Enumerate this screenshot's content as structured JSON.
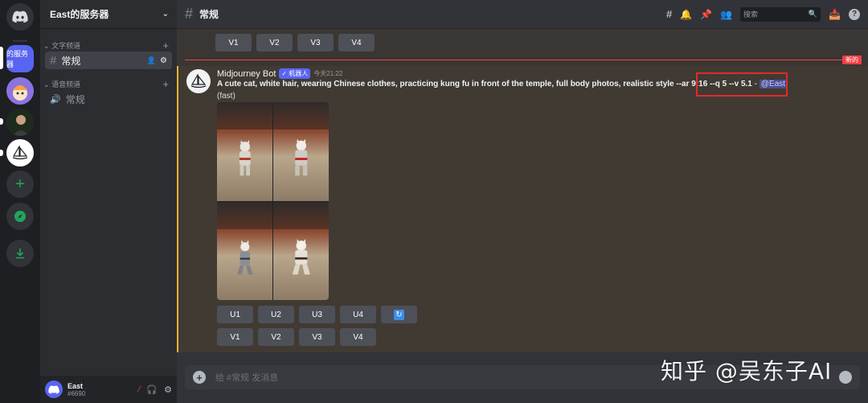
{
  "guild": {
    "name": "East的服务器",
    "short_label": "的服务器"
  },
  "sidebar": {
    "categories": [
      {
        "label": "文字频道",
        "channels": [
          {
            "label": "常规"
          }
        ]
      },
      {
        "label": "语音频道",
        "channels": [
          {
            "label": "常规"
          }
        ]
      }
    ]
  },
  "user": {
    "name": "East",
    "tag": "#6690"
  },
  "channel": {
    "name": "常规"
  },
  "search": {
    "placeholder": "搜索"
  },
  "divider": {
    "new_label": "新的"
  },
  "message": {
    "author": "Midjourney Bot",
    "bot_badge": "✓ 机器人",
    "timestamp": "今天21:22",
    "prompt": "A cute cat, white hair, wearing Chinese clothes, practicing kung fu in front of the temple, full body photos, realistic style ",
    "params": "--ar 9:16 --q 5 --v 5.1",
    "separator": " - ",
    "mention": "@East",
    "speed": "(fast)"
  },
  "buttons": {
    "top_row": [
      "V1",
      "V2",
      "V3",
      "V4"
    ],
    "upscale_row": [
      "U1",
      "U2",
      "U3",
      "U4"
    ],
    "variation_row": [
      "V1",
      "V2",
      "V3",
      "V4"
    ]
  },
  "composer": {
    "placeholder": "给 #常规 发消息"
  },
  "watermark": "知乎 @吴东子AI",
  "colors": {
    "accent": "#5865f2",
    "highlight_border": "#e12a2a",
    "mention_border": "#f0b232",
    "new_red": "#f23f43"
  }
}
